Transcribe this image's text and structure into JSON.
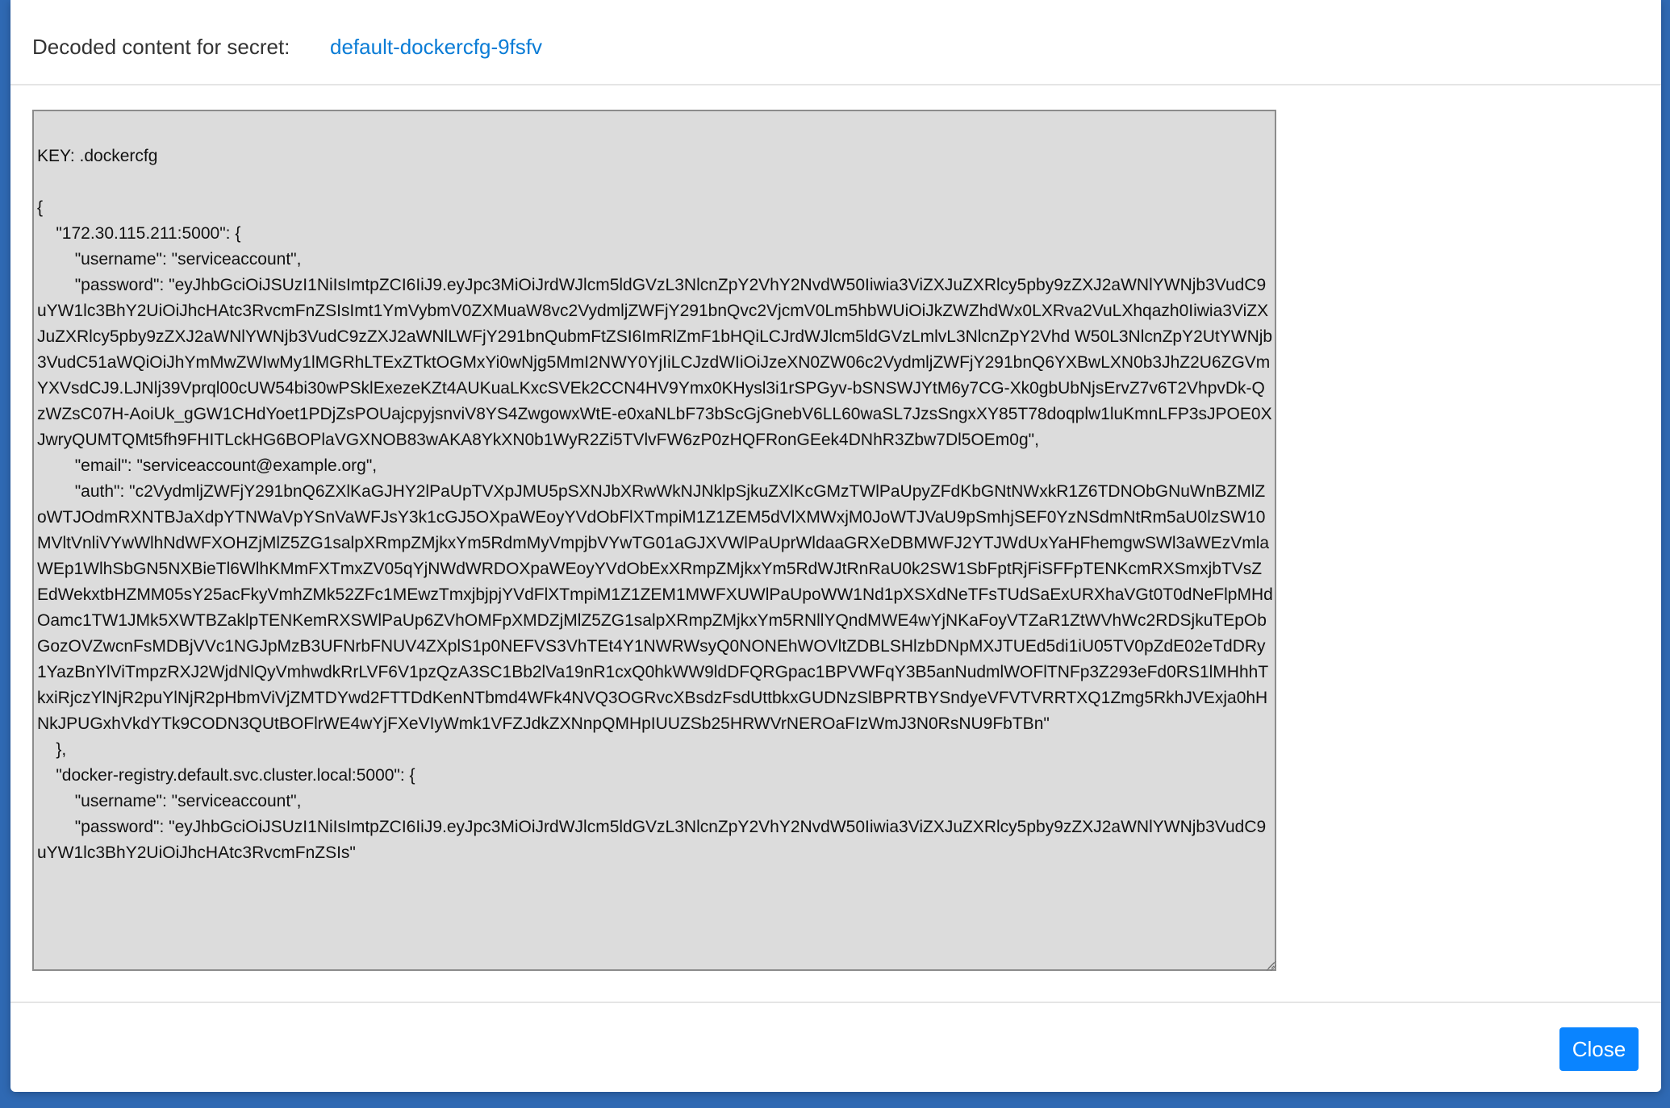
{
  "header": {
    "label": "Decoded content for secret:",
    "secret_name": "default-dockercfg-9fsfv"
  },
  "body": {
    "content": "KEY: .dockercfg\n\n{\n    \"172.30.115.211:5000\": {\n        \"username\": \"serviceaccount\",\n        \"password\": \"eyJhbGciOiJSUzI1NiIsImtpZCI6IiJ9.eyJpc3MiOiJrdWJlcm5ldGVzL3NlcnZpY2VhY2NvdW50Iiwia3ViZXJuZXRlcy5pby9zZXJ2aWNlYWNjb3VudC9uYW1lc3BhY2UiOiJhcHAtc3RvcmFnZSIsImt1YmVybmV0ZXMuaW8vc2VydmljZWFjY291bnQvc2VjcmV0Lm5hbWUiOiJkZWZhdWx0LXRva2VuLXhqazh0Iiwia3ViZXJuZXRlcy5pby9zZXJ2aWNlYWNjb3VudC9zZXJ2aWNlLWFjY291bnQubmFtZSI6ImRlZmF1bHQiLCJrdWJlcm5ldGVzLmlvL3NlcnZpY2Vhd W50L3NlcnZpY2UtYWNjb3VudC51aWQiOiJhYmMwZWIwMy1lMGRhLTExZTktOGMxYi0wNjg5MmI2NWY0YjIiLCJzdWIiOiJzeXN0ZW06c2VydmljZWFjY291bnQ6YXBwLXN0b3JhZ2U6ZGVmYXVsdCJ9.LJNlj39Vprql00cUW54bi30wPSklExezeKZt4AUKuaLKxcSVEk2CCN4HV9Ymx0KHysl3i1rSPGyv-bSNSWJYtM6y7CG-Xk0gbUbNjsErvZ7v6T2VhpvDk-QzWZsC07H-AoiUk_gGW1CHdYoet1PDjZsPOUajcpyjsnviV8YS4ZwgowxWtE-e0xaNLbF73bScGjGnebV6LL60waSL7JzsSngxXY85T78doqplw1luKmnLFP3sJPOE0XJwryQUMTQMt5fh9FHITLckHG6BOPlaVGXNOB83wAKA8YkXN0b1WyR2Zi5TVlvFW6zP0zHQFRonGEek4DNhR3Zbw7Dl5OEm0g\",\n        \"email\": \"serviceaccount@example.org\",\n        \"auth\": \"c2VydmljZWFjY291bnQ6ZXlKaGJHY2lPaUpTVXpJMU5pSXNJbXRwWkNJNklpSjkuZXlKcGMzTWlPaUpyZFdKbGNtNWxkR1Z6TDNObGNuWnBZMlZoWTJOdmRXNTBJaXdpYTNWaVpYSnVaWFJsY3k1cGJ5OXpaWEoyYVdObFlXTmpiM1Z1ZEM5dVlXMWxjM0JoWTJVaU9pSmhjSEF0YzNSdmNtRm5aU0lzSW10MVltVnliVYwWlhNdWFXOHZjMlZ5ZG1salpXRmpZMjkxYm5RdmMyVmpjbVYwTG01aGJXVWlPaUprWldaaGRXeDBMWFJ2YTJWdUxYaHFhemgwSWl3aWEzVmlaWEp1WlhSbGN5NXBieTl6WlhKMmFXTmxZV05qYjNWdWRDOXpaWEoyYVdObExXRmpZMjkxYm5RdWJtRnRaU0k2SW1SbFptRjFiSFFpTENKcmRXSmxjbTVsZEdWekxtbHZMM05sY25acFkyVmhZMk52ZFc1MEwzTmxjbjpjYVdFlXTmpiM1Z1ZEM1MWFXUWlPaUpoWW1Nd1pXSXdNeTFsTUdSaExURXhaVGt0T0dNeFlpMHdOamc1TW1JMk5XWTBZaklpTENKemRXSWlPaUp6ZVhOMFpXMDZjMlZ5ZG1salpXRmpZMjkxYm5RNllYQndMWE4wYjNKaFoyVTZaR1ZtWVhWc2RDSjkuTEpObGozOVZwcnFsMDBjVVc1NGJpMzB3UFNrbFNUV4ZXplS1p0NEFVS3VhTEt4Y1NWRWsyQ0NONEhWOVltZDBLSHlzbDNpMXJTUEd5di1iU05TV0pZdE02eTdDRy1YazBnYlViTmpzRXJ2WjdNlQyVmhwdkRrLVF6V1pzQzA3SC1Bb2lVa19nR1cxQ0hkWW9ldDFQRGpac1BPVWFqY3B5anNudmlWOFlTNFp3Z293eFd0RS1lMHhhTkxiRjczYlNjR2puYlNjR2pHbmViVjZMTDYwd2FTTDdKenNTbmd4WFk4NVQ3OGRvcXBsdzFsdUttbkxGUDNzSlBPRTBYSndyeVFVTVRRTXQ1Zmg5RkhJVExja0hHNkJPUGxhVkdYTk9CODN3QUtBOFlrWE4wYjFXeVIyWmk1VFZJdkZXNnpQMHpIUUZSb25HRWVrNEROaFIzWmJ3N0RsNU9FbTBn\"\n    },\n    \"docker-registry.default.svc.cluster.local:5000\": {\n        \"username\": \"serviceaccount\",\n        \"password\": \"eyJhbGciOiJSUzI1NiIsImtpZCI6IiJ9.eyJpc3MiOiJrdWJlcm5ldGVzL3NlcnZpY2VhY2NvdW50Iiwia3ViZXJuZXRlcy5pby9zZXJ2aWNlYWNjb3VudC9uYW1lc3BhY2UiOiJhcHAtc3RvcmFnZSIs\""
  },
  "footer": {
    "close_label": "Close"
  },
  "colors": {
    "backdrop": "#2f69b3",
    "link": "#0a7cd6",
    "primary_button": "#0a84ff",
    "textarea_bg": "#dcdcdc"
  }
}
